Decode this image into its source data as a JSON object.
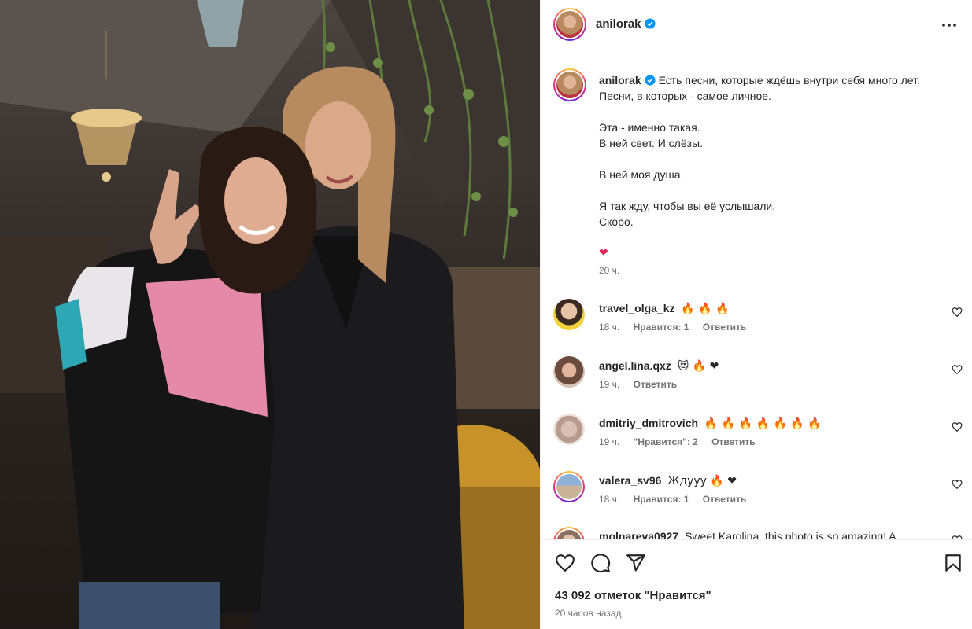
{
  "post": {
    "author": "anilorak",
    "caption_lines": [
      "Есть песни, которые ждёшь внутри себя много лет.",
      "Песни, в которых - самое личное.",
      "",
      "Эта - именно такая.",
      "В ней свет. И слёзы.",
      "",
      "В ней моя душа.",
      "",
      "Я так жду, чтобы вы её услышали.",
      "Скоро.",
      "",
      "❤"
    ],
    "caption_time": "20 ч.",
    "likes": "43 092 отметок \"Нравится\"",
    "posted_ago": "20 часов назад"
  },
  "comments": [
    {
      "user": "travel_olga_kz",
      "text": "🔥 🔥 🔥",
      "time": "18 ч.",
      "likes": "Нравится: 1",
      "reply": "Ответить"
    },
    {
      "user": "angel.lina.qxz",
      "text": "😻 🔥 ❤",
      "time": "19 ч.",
      "likes": "",
      "reply": "Ответить"
    },
    {
      "user": "dmitriy_dmitrovich",
      "text": "🔥 🔥 🔥 🔥 🔥 🔥 🔥",
      "time": "19 ч.",
      "likes": "\"Нравится\": 2",
      "reply": "Ответить"
    },
    {
      "user": "valera_sv96",
      "text": "Ждууу 🔥 ❤",
      "time": "18 ч.",
      "likes": "Нравится: 1",
      "reply": "Ответить"
    },
    {
      "user": "molnareva0927",
      "text": "Sweet Karolina, this photo is so amazing! A",
      "time": "",
      "likes": "",
      "reply": ""
    }
  ],
  "icons": {
    "more": "more-options-icon",
    "like": "heart-icon",
    "comment": "comment-icon",
    "share": "send-icon",
    "save": "bookmark-icon",
    "verified": "verified-badge-icon"
  },
  "colors": {
    "verified": "#0095f6",
    "heart": "#ff3040",
    "muted": "#737373",
    "text": "#262626"
  }
}
